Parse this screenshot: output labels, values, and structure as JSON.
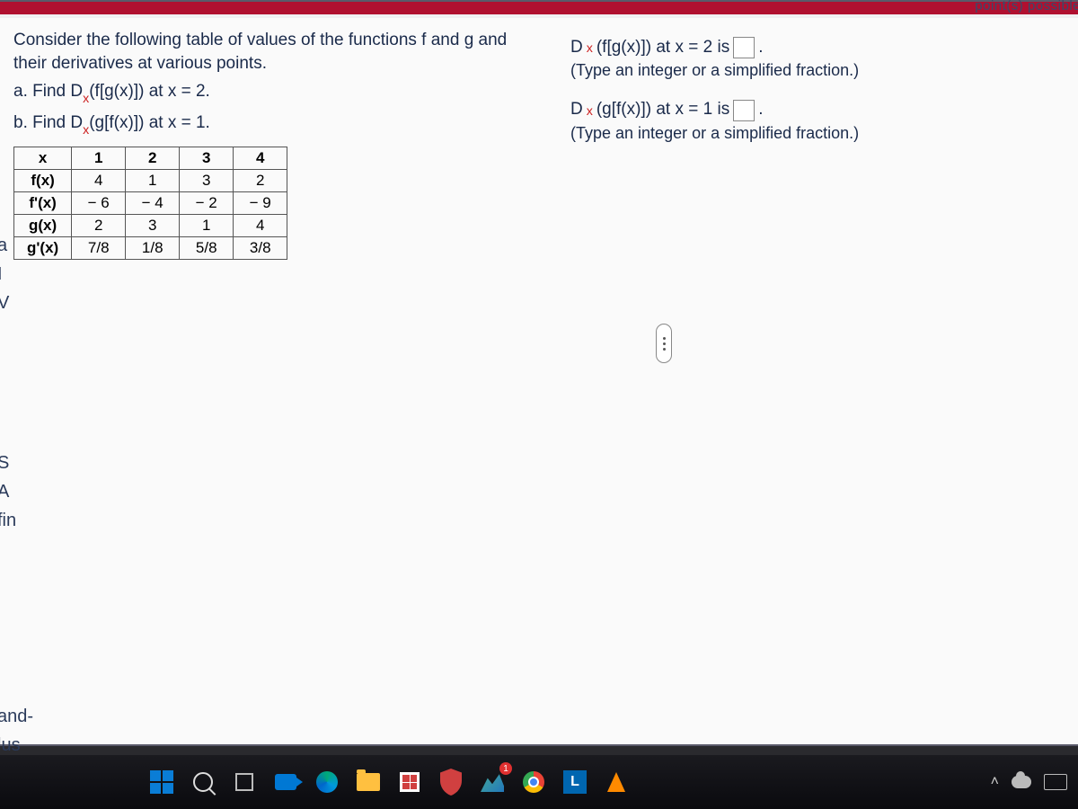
{
  "cutoff_text": "point(s) possible",
  "problem": {
    "intro": "Consider the following table of values of the functions f and g and their derivatives at various points.",
    "part_a_prefix": "a. Find D",
    "part_a_body": "(f[g(x)]) at x = 2.",
    "part_b_prefix": "b. Find D",
    "part_b_body": "(g[f(x)]) at x = 1.",
    "sub": "x"
  },
  "table": {
    "headers": [
      "x",
      "1",
      "2",
      "3",
      "4"
    ],
    "rows": [
      {
        "label": "f(x)",
        "vals": [
          "4",
          "1",
          "3",
          "2"
        ]
      },
      {
        "label": "f'(x)",
        "vals": [
          "− 6",
          "− 4",
          "− 2",
          "− 9"
        ]
      },
      {
        "label": "g(x)",
        "vals": [
          "2",
          "3",
          "1",
          "4"
        ]
      },
      {
        "label": "g'(x)",
        "vals": [
          "7/8",
          "1/8",
          "5/8",
          "3/8"
        ]
      }
    ]
  },
  "answers": {
    "line1_prefix": "D",
    "line1_body": "(f[g(x)]) at x = 2 is",
    "line1_end": ".",
    "hint1": "(Type an integer or a simplified fraction.)",
    "line2_prefix": "D",
    "line2_body": "(g[f(x)]) at x = 1 is",
    "line2_end": ".",
    "hint2": "(Type an integer or a simplified fraction.)"
  },
  "left_edge": {
    "l1": "a",
    "l2": "I",
    "l3": "V",
    "l4": "S",
    "l5": "A",
    "l6": " fin",
    "l7": "and-",
    "l8": "lus"
  },
  "taskbar": {
    "L": "L",
    "badge": "1"
  }
}
